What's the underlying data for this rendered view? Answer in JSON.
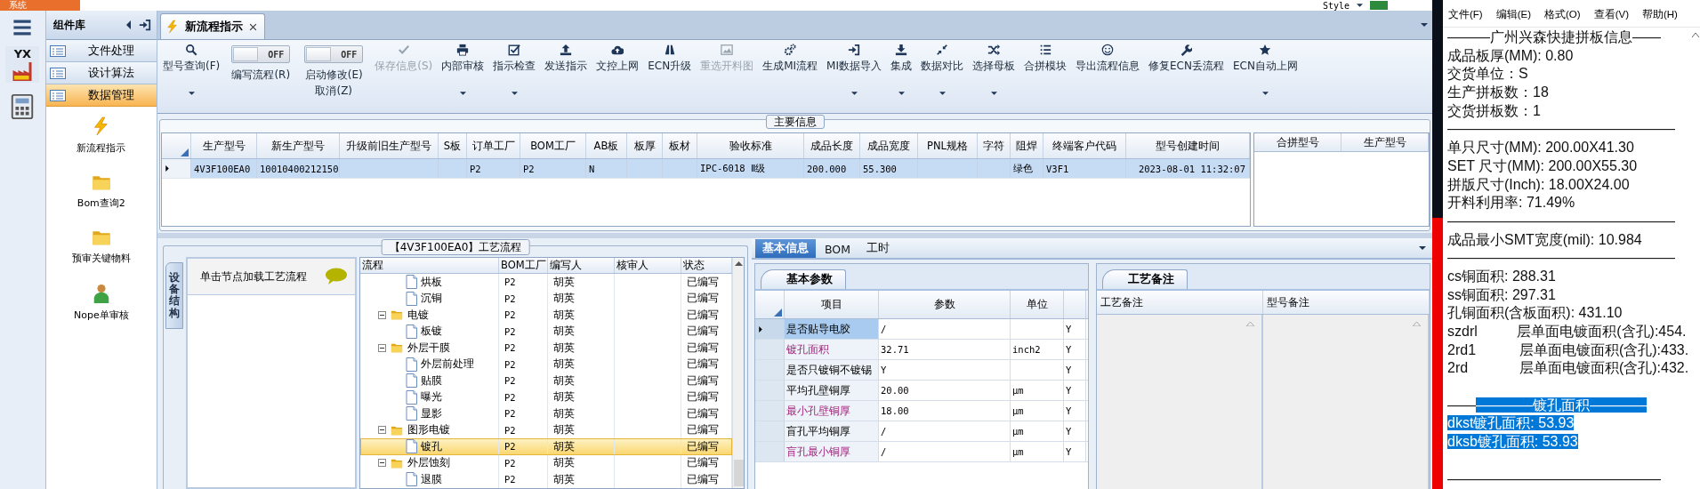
{
  "system_menu": "系统",
  "style_menu": "Style",
  "app_logo": "YX",
  "component_library": {
    "title": "组件库",
    "categories": [
      {
        "label": "文件处理",
        "selected": false
      },
      {
        "label": "设计算法",
        "selected": false
      },
      {
        "label": "数据管理",
        "selected": true
      }
    ],
    "items": [
      "新流程指示",
      "Bom查询2",
      "预审关键物料",
      "Nope单审核"
    ]
  },
  "document_tab": {
    "title": "新流程指示"
  },
  "ribbon": [
    {
      "kind": "button",
      "label": "型号查询(F)",
      "dropdown": true,
      "disabled": false
    },
    {
      "kind": "toggle",
      "label": "编写流程(R)",
      "switch_text": "OFF",
      "on": false
    },
    {
      "kind": "toggle",
      "label": "启动修改(E)\n取消(Z)",
      "switch_text": "OFF",
      "on": false
    },
    {
      "kind": "button",
      "label": "保存信息(S)",
      "dropdown": false,
      "disabled": true
    },
    {
      "kind": "button",
      "label": "内部审核",
      "dropdown": true,
      "disabled": false
    },
    {
      "kind": "button",
      "label": "指示检查",
      "dropdown": true,
      "disabled": false
    },
    {
      "kind": "button",
      "label": "发送指示",
      "dropdown": false,
      "disabled": false
    },
    {
      "kind": "button",
      "label": "文控上网",
      "dropdown": false,
      "disabled": false
    },
    {
      "kind": "button",
      "label": "ECN升级",
      "dropdown": false,
      "disabled": false
    },
    {
      "kind": "button",
      "label": "重选开料图",
      "dropdown": false,
      "disabled": true
    },
    {
      "kind": "button",
      "label": "生成MI流程",
      "dropdown": false,
      "disabled": false
    },
    {
      "kind": "button",
      "label": "MI数据导入",
      "dropdown": true,
      "disabled": false
    },
    {
      "kind": "button",
      "label": "集成",
      "dropdown": true,
      "disabled": false
    },
    {
      "kind": "button",
      "label": "数据对比",
      "dropdown": true,
      "disabled": false
    },
    {
      "kind": "button",
      "label": "选择母板",
      "dropdown": true,
      "disabled": false
    },
    {
      "kind": "button",
      "label": "合拼模块",
      "dropdown": false,
      "disabled": false
    },
    {
      "kind": "button",
      "label": "导出流程信息",
      "dropdown": false,
      "disabled": false
    },
    {
      "kind": "button",
      "label": "修复ECN丢流程",
      "dropdown": false,
      "disabled": false
    },
    {
      "kind": "button",
      "label": "ECN自动上网",
      "dropdown": true,
      "disabled": false
    }
  ],
  "main_info": {
    "title": "主要信息",
    "columns": [
      "生产型号",
      "新生产型号",
      "升级前旧生产型号",
      "S板",
      "订单工厂",
      "BOM工厂",
      "AB板",
      "板厚",
      "板材",
      "验收标准",
      "成品长度",
      "成品宽度",
      "PNL规格",
      "字符",
      "阻焊",
      "终端客户代码",
      "型号创建时间"
    ],
    "rows": [
      {
        "selected": true,
        "cells": [
          "4V3F100EA0",
          "10010400212150",
          null,
          null,
          "P2",
          "P2",
          "N",
          null,
          null,
          "IPC-6018 Ⅱ级",
          "200.000",
          "55.300",
          null,
          null,
          "绿色",
          "V3F1",
          "2023-08-01 11:32:07"
        ]
      }
    ],
    "side_table": {
      "columns": [
        "合拼型号",
        "生产型号"
      ]
    }
  },
  "process_panel": {
    "title": "【4V3F100EA0】工艺流程",
    "side_tab": "设备结构",
    "hint": "单击节点加载工艺流程",
    "columns": [
      "流程",
      "BOM工厂",
      "编写人",
      "核审人",
      "状态"
    ],
    "nodes": [
      {
        "children": [
          {
            "label": "烘板",
            "bom_factory": "P2",
            "author": "胡英",
            "status": "已编写",
            "selected": false
          },
          {
            "label": "沉铜",
            "bom_factory": "P2",
            "author": "胡英",
            "status": "已编写",
            "selected": false
          }
        ]
      },
      {
        "label": "电镀",
        "bom_factory": "P2",
        "author": "胡英",
        "status": "已编写",
        "selected": false,
        "expanded": true,
        "children": [
          {
            "label": "板镀",
            "bom_factory": "P2",
            "author": "胡英",
            "status": "已编写",
            "selected": false
          }
        ]
      },
      {
        "label": "外层干膜",
        "bom_factory": "P2",
        "author": "胡英",
        "status": "已编写",
        "selected": false,
        "expanded": true,
        "children": [
          {
            "label": "外层前处理",
            "bom_factory": "P2",
            "author": "胡英",
            "status": "已编写",
            "selected": false
          },
          {
            "label": "贴膜",
            "bom_factory": "P2",
            "author": "胡英",
            "status": "已编写",
            "selected": false
          },
          {
            "label": "曝光",
            "bom_factory": "P2",
            "author": "胡英",
            "status": "已编写",
            "selected": false
          },
          {
            "label": "显影",
            "bom_factory": "P2",
            "author": "胡英",
            "status": "已编写",
            "selected": false
          }
        ]
      },
      {
        "label": "图形电镀",
        "bom_factory": "P2",
        "author": "胡英",
        "status": "已编写",
        "selected": false,
        "expanded": true,
        "children": [
          {
            "label": "镀孔",
            "bom_factory": "P2",
            "author": "胡英",
            "status": "已编写",
            "selected": true
          }
        ]
      },
      {
        "label": "外层蚀刻",
        "bom_factory": "P2",
        "author": "胡英",
        "status": "已编写",
        "selected": false,
        "expanded": true,
        "children": [
          {
            "label": "退膜",
            "bom_factory": "P2",
            "author": "胡英",
            "status": "已编写",
            "selected": false
          }
        ]
      }
    ]
  },
  "detail_tabs": [
    {
      "label": "基本信息",
      "selected": true
    },
    {
      "label": "BOM",
      "selected": false
    },
    {
      "label": "工时",
      "selected": false
    }
  ],
  "basic_params": {
    "title": "基本参数",
    "columns": [
      "项目",
      "参数",
      "单位"
    ],
    "rows": [
      {
        "item": "是否贴导电胶",
        "value": "/",
        "column_5": "Y",
        "emphasized": false,
        "selected": true
      },
      {
        "item": "镀孔面积",
        "value": "32.71",
        "unit": "inch2",
        "column_5": "Y",
        "emphasized": true,
        "selected": false
      },
      {
        "item": "是否只镀铜不镀锡",
        "value": "Y",
        "column_5": "Y",
        "emphasized": false,
        "selected": false
      },
      {
        "item": "平均孔壁铜厚",
        "value": "20.00",
        "unit": "µm",
        "column_5": "Y",
        "emphasized": false,
        "selected": false
      },
      {
        "item": "最小孔壁铜厚",
        "value": "18.00",
        "unit": "µm",
        "column_5": "Y",
        "emphasized": true,
        "selected": false
      },
      {
        "item": "盲孔平均铜厚",
        "value": "/",
        "unit": "µm",
        "column_5": "Y",
        "emphasized": false,
        "selected": false
      },
      {
        "item": "盲孔最小铜厚",
        "value": "/",
        "unit": "µm",
        "column_5": "Y",
        "emphasized": true,
        "selected": false
      }
    ]
  },
  "remarks": {
    "title": "工艺备注",
    "columns": [
      "工艺备注",
      "型号备注"
    ]
  },
  "notepad": {
    "menu": [
      "文件(F)",
      "编辑(E)",
      "格式(O)",
      "查看(V)",
      "帮助(H)"
    ],
    "lines": [
      {
        "text": "———广州兴森快捷拼板信息——",
        "selected": false
      },
      {
        "text": "成品板厚(MM): 0.80",
        "selected": false
      },
      {
        "text": "交货单位：S",
        "selected": false
      },
      {
        "text": "生产拼板数：18",
        "selected": false
      },
      {
        "text": "交货拼板数：1",
        "selected": false
      },
      {
        "text": "————————————————",
        "selected": false
      },
      {
        "text": "单只尺寸(MM): 200.00X41.30",
        "selected": false
      },
      {
        "text": "SET 尺寸(MM): 200.00X55.30",
        "selected": false
      },
      {
        "text": "拼版尺寸(Inch): 18.00X24.00",
        "selected": false
      },
      {
        "text": "开料利用率: 71.49%",
        "selected": false
      },
      {
        "text": "————————————————",
        "selected": false
      },
      {
        "text": "成品最小SMT宽度(mil): 10.984",
        "selected": false
      },
      {
        "text": "————————————————",
        "selected": false
      },
      {
        "text": "cs铜面积: 288.31",
        "selected": false
      },
      {
        "text": "ss铜面积: 297.31",
        "selected": false
      },
      {
        "text": "孔铜面积(含板面积): 431.10",
        "selected": false
      },
      {
        "text": "szdrl          层单面电镀面积(含孔):454.",
        "selected": false
      },
      {
        "text": "2rd1           层单面电镀面积(含孔):433.",
        "selected": false
      },
      {
        "text": "2rd             层单面电镀面积(含孔):432.",
        "selected": false
      },
      {
        "lead": "——",
        "text": "————镀孔面积————",
        "selected": true,
        "space_before": true
      },
      {
        "text": "dkst镀孔面积: 53.93",
        "selected": true
      },
      {
        "text": "dksb镀孔面积: 53.93",
        "selected": true
      },
      {
        "text": "———————————————",
        "selected": false,
        "space_before": true
      }
    ]
  }
}
